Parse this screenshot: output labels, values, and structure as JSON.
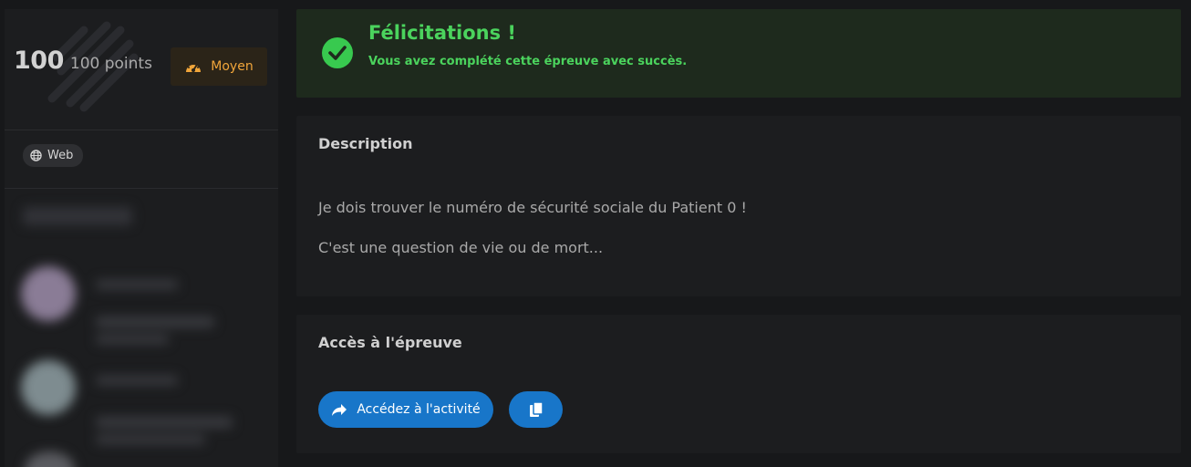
{
  "sidebar": {
    "points_value": "100",
    "points_label": "100 points",
    "difficulty": {
      "label": "Moyen",
      "icon": "speedometer-icon",
      "color": "#f0a53a"
    },
    "tag": {
      "label": "Web",
      "icon": "globe-icon"
    }
  },
  "banner": {
    "title": "Félicitations !",
    "subtitle": "Vous avez complété cette épreuve avec succès.",
    "icon": "check-circle-icon",
    "color": "#4bd35d"
  },
  "description": {
    "title": "Description",
    "lines": [
      "Je dois trouver le numéro de sécurité sociale du Patient 0 !",
      "C'est une question de vie ou de mort..."
    ]
  },
  "access": {
    "title": "Accès à l'épreuve",
    "access_button_label": "Accédez à l'activité",
    "access_button_icon": "share-arrow-icon",
    "copy_button_icon": "copy-icon",
    "button_color": "#1876c9"
  }
}
